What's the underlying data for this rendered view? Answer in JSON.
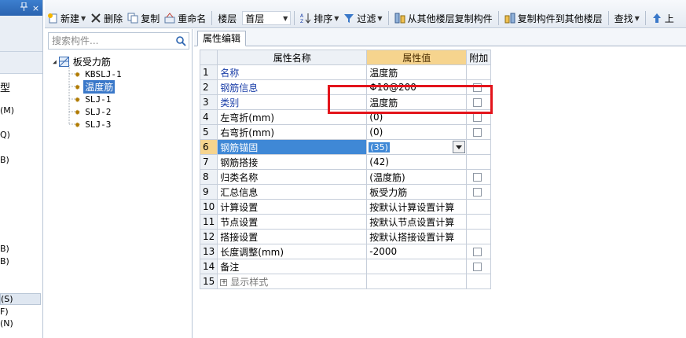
{
  "left_panel": {
    "header_pin": "ᅟ",
    "header_close": "×",
    "fragments": [
      "型",
      "(M)",
      "Q)",
      "B)",
      "B)",
      "B)",
      "(S)",
      "F)",
      "(N)"
    ]
  },
  "toolbar": {
    "new_label": "新建",
    "delete_label": "删除",
    "copy_label": "复制",
    "rename_label": "重命名",
    "floor_label": "楼层",
    "floor_value": "首层",
    "sort_label": "排序",
    "filter_label": "过滤",
    "copy_from_other_label": "从其他楼层复制构件",
    "copy_to_other_label": "复制构件到其他楼层",
    "find_label": "查找",
    "up_label": "上"
  },
  "tree": {
    "search_placeholder": "搜索构件...",
    "root_label": "板受力筋",
    "children": [
      "KBSLJ-1",
      "温度筋",
      "SLJ-1",
      "SLJ-2",
      "SLJ-3"
    ]
  },
  "properties": {
    "tab_label": "属性编辑",
    "col_name": "属性名称",
    "col_value": "属性值",
    "col_extra": "附加",
    "rows": [
      {
        "num": "1",
        "name": "名称",
        "value": "温度筋",
        "checkbox": false
      },
      {
        "num": "2",
        "name": "钢筋信息",
        "value": "Φ10@200",
        "checkbox": true
      },
      {
        "num": "3",
        "name": "类别",
        "value": "温度筋",
        "checkbox": true
      },
      {
        "num": "4",
        "name": "左弯折(mm)",
        "value": "(0)",
        "checkbox": true
      },
      {
        "num": "5",
        "name": "右弯折(mm)",
        "value": "(0)",
        "checkbox": true
      },
      {
        "num": "6",
        "name": "钢筋锚固",
        "value": "(35)",
        "checkbox": false
      },
      {
        "num": "7",
        "name": "钢筋搭接",
        "value": "(42)",
        "checkbox": false
      },
      {
        "num": "8",
        "name": "归类名称",
        "value": "(温度筋)",
        "checkbox": true
      },
      {
        "num": "9",
        "name": "汇总信息",
        "value": "板受力筋",
        "checkbox": true
      },
      {
        "num": "10",
        "name": "计算设置",
        "value": "按默认计算设置计算",
        "checkbox": false
      },
      {
        "num": "11",
        "name": "节点设置",
        "value": "按默认节点设置计算",
        "checkbox": false
      },
      {
        "num": "12",
        "name": "搭接设置",
        "value": "按默认搭接设置计算",
        "checkbox": false
      },
      {
        "num": "13",
        "name": "长度调整(mm)",
        "value": "-2000",
        "checkbox": true
      },
      {
        "num": "14",
        "name": "备注",
        "value": "",
        "checkbox": true
      },
      {
        "num": "15",
        "name": "显示样式",
        "value": "",
        "checkbox": false
      }
    ]
  }
}
